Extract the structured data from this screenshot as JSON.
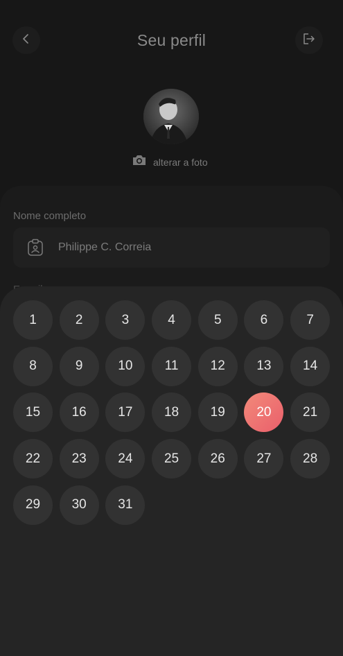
{
  "header": {
    "title": "Seu perfil",
    "back_icon": "chevron-left-icon",
    "logout_icon": "logout-icon"
  },
  "profile": {
    "photo_label": "alterar a foto",
    "camera_icon": "camera-icon"
  },
  "form": {
    "full_name_label": "Nome completo",
    "full_name_value": "Philippe C. Correia",
    "full_name_icon": "id-badge-icon",
    "email_label": "E-mail"
  },
  "day_picker": {
    "days": [
      "1",
      "2",
      "3",
      "4",
      "5",
      "6",
      "7",
      "8",
      "9",
      "10",
      "11",
      "12",
      "13",
      "14",
      "15",
      "16",
      "17",
      "18",
      "19",
      "20",
      "21",
      "22",
      "23",
      "24",
      "25",
      "26",
      "27",
      "28",
      "29",
      "30",
      "31"
    ],
    "selected_day": "20",
    "accent_color": "#ef6f6f"
  }
}
